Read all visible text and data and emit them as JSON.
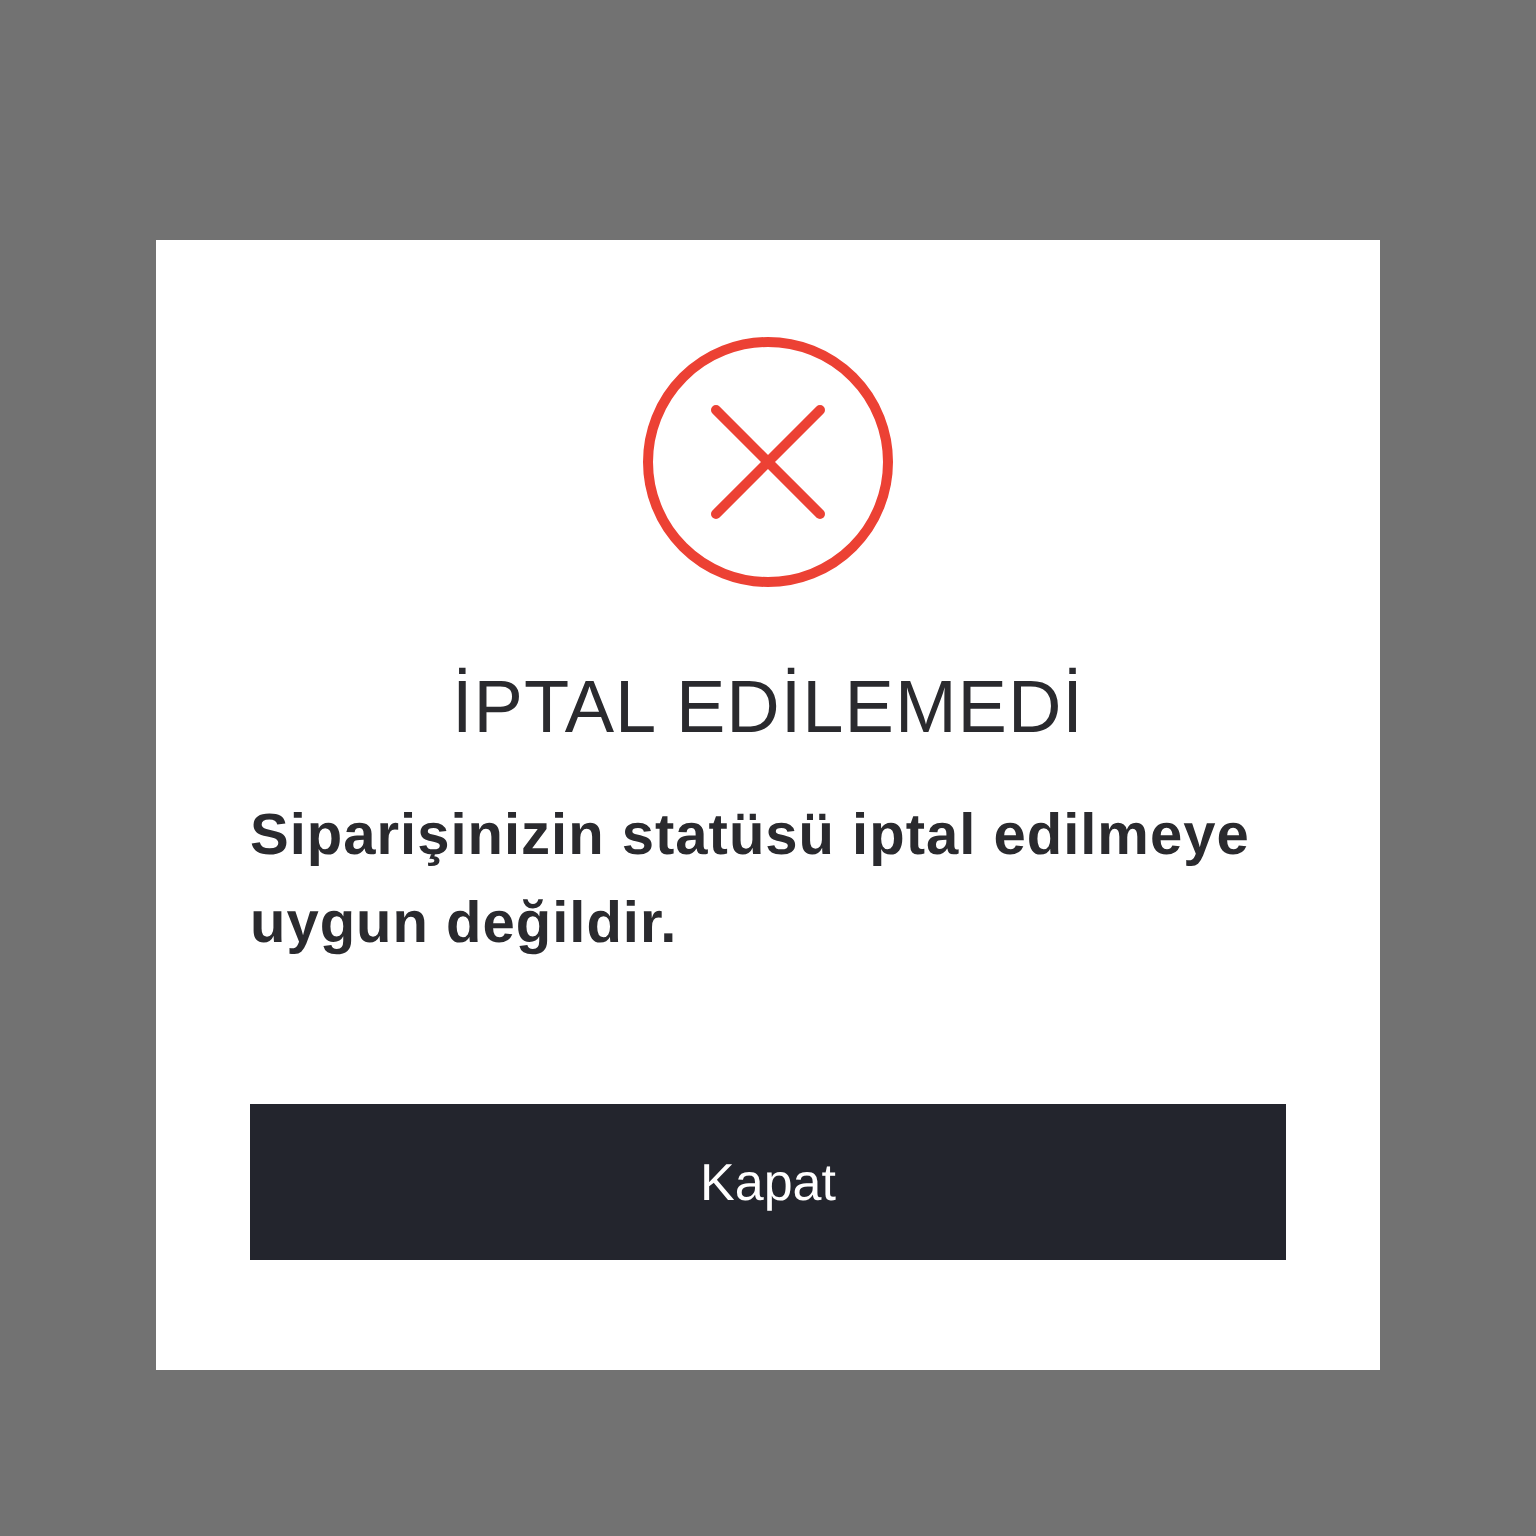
{
  "dialog": {
    "icon": {
      "kind": "error"
    },
    "title": "İPTAL EDİLEMEDİ",
    "message": "Siparişinizin statüsü iptal edilmeye uygun değildir.",
    "buttons": [
      {
        "label": "Kapat"
      }
    ]
  }
}
